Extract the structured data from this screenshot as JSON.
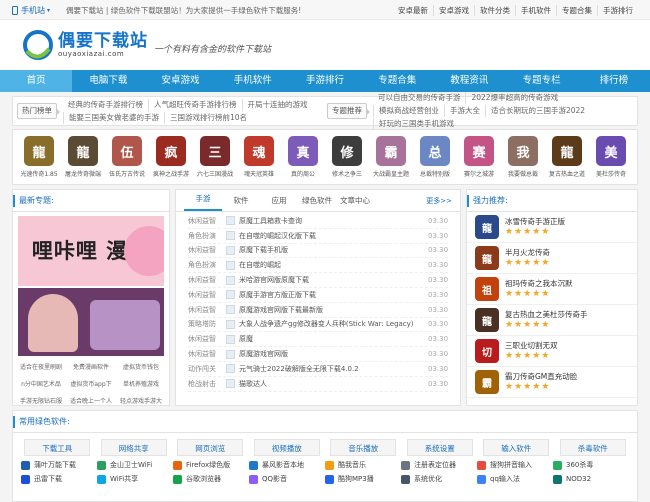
{
  "topbar": {
    "mobile_label": "手机站",
    "slogan": "偶要下载站 | 绿色软件下载联盟站！为大家提供一手绿色软件下载服务!",
    "links": [
      "安卓最新",
      "安卓游戏",
      "软件分类",
      "手机软件",
      "专题合集",
      "手游排行"
    ]
  },
  "header": {
    "logo_cn": "偶要下载站",
    "logo_en": "ouyaoxiazai.com",
    "tagline": "一个有料有含金的软件下载站",
    "logo_colors": {
      "blue": "#1574c9",
      "green": "#7cc242"
    }
  },
  "nav": {
    "items": [
      "首页",
      "电脑下载",
      "安卓游戏",
      "手机软件",
      "手游排行",
      "专题合集",
      "教程资讯",
      "专题专栏",
      "排行榜"
    ],
    "active_index": 0,
    "color": "#1e90cf"
  },
  "hot": {
    "label": "热门榜单",
    "links": [
      "经典的传奇手游排行榜",
      "人气超旺传奇手游排行榜",
      "开局十连抽的游戏",
      "能娶三国美女做老婆的手游",
      "三国游戏排行榜前10名"
    ],
    "rec_label": "专题推荐",
    "rec_links": [
      "可以自由交易的传奇手游",
      "2022爆率超高的传奇游戏",
      "模拟商战经营创业",
      "手游大全",
      "适合长期玩的三国手游2022",
      "好玩的三国类手机游戏"
    ]
  },
  "apps": [
    {
      "name": "光速传奇1.85",
      "color": "#8a6d2b",
      "glyph": "龍"
    },
    {
      "name": "屠龙传奇微端",
      "color": "#5b4a34",
      "glyph": "龍"
    },
    {
      "name": "伍氏万古传说",
      "color": "#b0564a",
      "glyph": "伍"
    },
    {
      "name": "疯神之战手游",
      "color": "#9b2b20",
      "glyph": "疯"
    },
    {
      "name": "六七三国漫战",
      "color": "#7a2a2a",
      "glyph": "三"
    },
    {
      "name": "魂天冠英雄",
      "color": "#c0392b",
      "glyph": "魂"
    },
    {
      "name": "真的周公",
      "color": "#7c5cb8",
      "glyph": "真"
    },
    {
      "name": "修术之争三",
      "color": "#3d3d3d",
      "glyph": "修"
    },
    {
      "name": "大战霸皇主题",
      "color": "#a8739b",
      "glyph": "霸"
    },
    {
      "name": "总裁特别版",
      "color": "#6c88c4",
      "glyph": "总"
    },
    {
      "name": "赛尔之城游",
      "color": "#c45486",
      "glyph": "赛"
    },
    {
      "name": "我要做总裁",
      "color": "#8d6e63",
      "glyph": "我"
    },
    {
      "name": "复古热血之道",
      "color": "#5d3a1a",
      "glyph": "龍"
    },
    {
      "name": "美杜莎传奇",
      "color": "#6a4bb0",
      "glyph": "美"
    }
  ],
  "latest": {
    "title": "最新专题:",
    "banner1_text": "哩咔哩 漫画",
    "links": [
      "适合在夜里刷剧",
      "免费漫画软件",
      "虚拟货币钱包",
      "n分中国艺术品",
      "虚拟货币app下",
      "单机养殖游戏",
      "手游无限钻石服",
      "适合晚上一个人",
      "轻点游戏手游大"
    ]
  },
  "tabs": {
    "items": [
      "手游",
      "软件",
      "应用",
      "绿色软件",
      "文章中心"
    ],
    "active_index": 0,
    "more": "更多>>"
  },
  "articles": [
    {
      "cat": "休闲益智",
      "title": "原魔工具箱救卡查询",
      "date": "03.30"
    },
    {
      "cat": "角色扮演",
      "title": "在自噬的崛起汉化版下载",
      "date": "03.30"
    },
    {
      "cat": "休闲益智",
      "title": "原魔下载手机版",
      "date": "03.30"
    },
    {
      "cat": "角色扮演",
      "title": "在自噬的崛起",
      "date": "03.30"
    },
    {
      "cat": "休闲益智",
      "title": "米哈游官网版原魔下载",
      "date": "03.30"
    },
    {
      "cat": "休闲益智",
      "title": "原魔手游官方版正版下载",
      "date": "03.30"
    },
    {
      "cat": "休闲益智",
      "title": "原魔游戏官网版下载最新版",
      "date": "03.30"
    },
    {
      "cat": "策略塔防",
      "title": "大象人战争遗产gg修改器变人兵种(Stick War: Legacy)",
      "date": "03.30"
    },
    {
      "cat": "休闲益智",
      "title": "原魔",
      "date": "03.30"
    },
    {
      "cat": "休闲益智",
      "title": "原魔游戏官网版",
      "date": "03.30"
    },
    {
      "cat": "动作闯关",
      "title": "元气骑士2022破解版全无限下载4.0.2",
      "date": "03.30"
    },
    {
      "cat": "枪战射击",
      "title": "猫歌达人",
      "date": "03.30"
    }
  ],
  "ranking": {
    "title": "强力推荐:",
    "items": [
      {
        "name": "冰雪传奇手游正版",
        "color": "#2b4a8c",
        "glyph": "龍",
        "stars": "★★★★★"
      },
      {
        "name": "半月火龙传奇",
        "color": "#8b3a1a",
        "glyph": "龍",
        "stars": "★★★★★"
      },
      {
        "name": "祖玛传奇之我本沉默",
        "color": "#c2410c",
        "glyph": "祖",
        "stars": "★★★★★"
      },
      {
        "name": "复古热血之美杜莎传奇手",
        "color": "#4a2f24",
        "glyph": "龍",
        "stars": "★★★★★"
      },
      {
        "name": "三职业切割无双",
        "color": "#b91c1c",
        "glyph": "切",
        "stars": "★★★★★"
      },
      {
        "name": "霸刀传奇GM直充动脸",
        "color": "#a16207",
        "glyph": "霸",
        "stars": "★★★★★"
      }
    ]
  },
  "soft": {
    "title": "常用绿色软件:",
    "cats": [
      "下载工具",
      "网络共享",
      "网页浏览",
      "视频播放",
      "音乐播放",
      "系统设置",
      "输入软件",
      "杀毒软件"
    ],
    "items": [
      {
        "name": "蒲叶万能下载",
        "color": "#1e5fae"
      },
      {
        "name": "金山卫士WiFi",
        "color": "#2a9d5f"
      },
      {
        "name": "Firefox绿色版",
        "color": "#e8640c"
      },
      {
        "name": "暴风影音本地",
        "color": "#1e7ac7"
      },
      {
        "name": "酷我音乐",
        "color": "#f39c12"
      },
      {
        "name": "注册表定位器",
        "color": "#6b7280"
      },
      {
        "name": "搜狗拼音输入",
        "color": "#e74c3c"
      },
      {
        "name": "360杀毒",
        "color": "#27ae60"
      },
      {
        "name": "迅雷下载",
        "color": "#1d4ed8"
      },
      {
        "name": "WiFi共享",
        "color": "#0ea5e9"
      },
      {
        "name": "谷歌浏览器",
        "color": "#16a34a"
      },
      {
        "name": "QQ影音",
        "color": "#8b5cf6"
      },
      {
        "name": "酷狗MP3播",
        "color": "#2563eb"
      },
      {
        "name": "系统优化",
        "color": "#475569"
      },
      {
        "name": "qq输入法",
        "color": "#3b82f6"
      },
      {
        "name": "NOD32",
        "color": "#0f766e"
      }
    ]
  }
}
